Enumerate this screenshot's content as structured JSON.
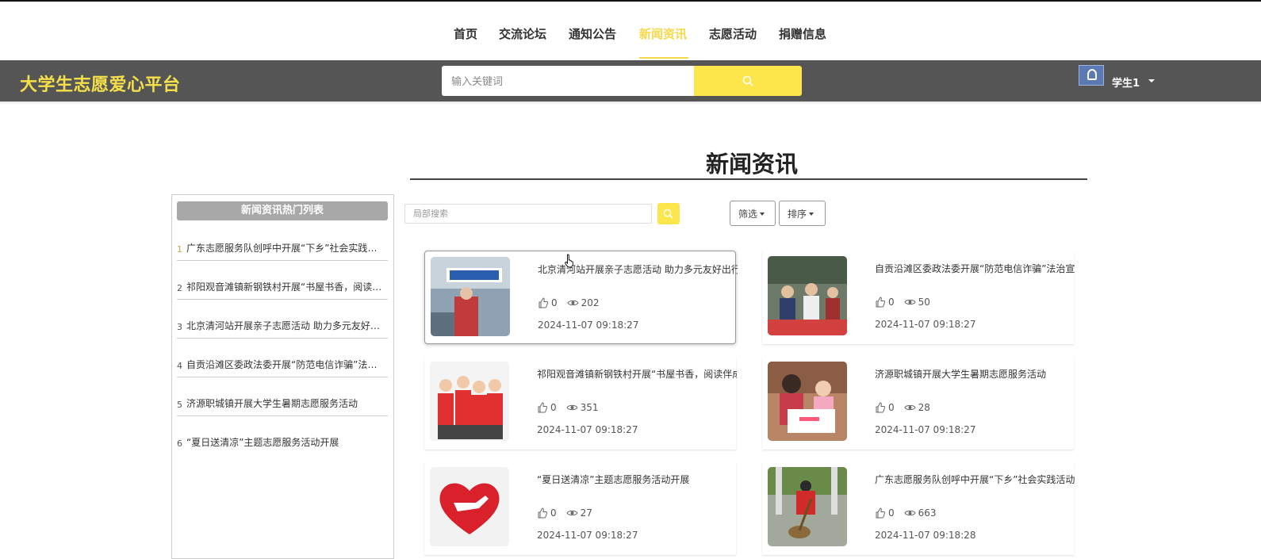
{
  "nav": {
    "items": [
      "首页",
      "交流论坛",
      "通知公告",
      "新闻资讯",
      "志愿活动",
      "捐赠信息"
    ],
    "active": "新闻资讯",
    "accent_color": "#f6d94a"
  },
  "header": {
    "brand": "大学生志愿爱心平台",
    "search_placeholder": "输入关键词",
    "search_icon": "search-icon",
    "username": "学生1",
    "avatar_icon": "avatar-icon",
    "bg_color": "#555555",
    "brand_color": "#f5e04a"
  },
  "main": {
    "title": "新闻资讯"
  },
  "sidebar": {
    "title": "新闻资讯热门列表",
    "items": [
      {
        "num": "1",
        "text": "广东志愿服务队创呼中开展“下乡”社会实践活动"
      },
      {
        "num": "2",
        "text": "祁阳观音滩镇新钢铁村开展“书屋书香，阅读伴成长”活动"
      },
      {
        "num": "3",
        "text": "北京清河站开展亲子志愿活动 助力多元友好出行"
      },
      {
        "num": "4",
        "text": "自贡沿滩区委政法委开展“防范电信诈骗”法治宣传活动"
      },
      {
        "num": "5",
        "text": "济源职城镇开展大学生暑期志愿服务活动"
      },
      {
        "num": "6",
        "text": "“夏日送清凉”主题志愿服务活动开展"
      }
    ]
  },
  "filters": {
    "local_search_placeholder": "局部搜索",
    "filter_label": "筛选",
    "sort_label": "排序"
  },
  "news": [
    {
      "title": "北京清河站开展亲子志愿活动 助力多元友好出行",
      "likes": "0",
      "views": "202",
      "date": "2024-11-07 09:18:27",
      "thumb": "station-photo"
    },
    {
      "title": "自贡沿滩区委政法委开展“防范电信诈骗”法治宣传活动",
      "likes": "0",
      "views": "50",
      "date": "2024-11-07 09:18:27",
      "thumb": "crowd-photo"
    },
    {
      "title": "祁阳观音滩镇新钢铁村开展“书屋书香，阅读伴成长”活动",
      "likes": "0",
      "views": "351",
      "date": "2024-11-07 09:18:27",
      "thumb": "volunteers-cartoon"
    },
    {
      "title": "济源职城镇开展大学生暑期志愿服务活动",
      "likes": "0",
      "views": "28",
      "date": "2024-11-07 09:18:27",
      "thumb": "kids-drawing-photo"
    },
    {
      "title": "“夏日送清凉”主题志愿服务活动开展",
      "likes": "0",
      "views": "27",
      "date": "2024-11-07 09:18:27",
      "thumb": "heart-hand-logo"
    },
    {
      "title": "广东志愿服务队创呼中开展“下乡”社会实践活动",
      "likes": "0",
      "views": "663",
      "date": "2024-11-07 09:18:28",
      "thumb": "sweeping-photo"
    }
  ]
}
